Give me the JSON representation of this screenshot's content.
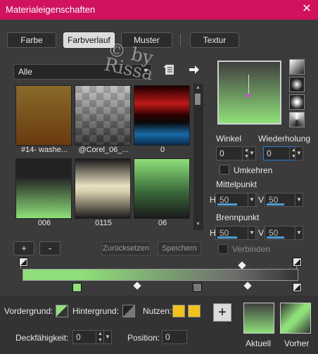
{
  "window": {
    "title": "Materialeigenschaften",
    "close_icon": "✕"
  },
  "tabs": [
    {
      "label": "Farbe"
    },
    {
      "label": "Farbverlauf"
    },
    {
      "label": "Muster"
    },
    {
      "label": "Textur"
    }
  ],
  "filter": {
    "value": "Alle",
    "arrow": "▼"
  },
  "gallery": [
    {
      "caption": "#14- washe..."
    },
    {
      "caption": "@Corel_06_..."
    },
    {
      "caption": "0"
    },
    {
      "caption": "006"
    },
    {
      "caption": "0115"
    },
    {
      "caption": "06"
    }
  ],
  "gallery_buttons": {
    "add": "+",
    "remove": "-",
    "reset": "Zurücksetzen",
    "save": "Speichern"
  },
  "watermark": {
    "line1": "© by",
    "line2": "Rissa"
  },
  "angle": {
    "label": "Winkel",
    "value": "0"
  },
  "repeat": {
    "label": "Wiederholung",
    "value": "0"
  },
  "invert": {
    "label": "Umkehren"
  },
  "midpoint": {
    "label": "Mittelpunkt",
    "h_label": "H",
    "h_value": "50",
    "v_label": "V",
    "v_value": "50"
  },
  "focal": {
    "label": "Brennpunkt",
    "h_label": "H",
    "h_value": "50",
    "v_label": "V",
    "v_value": "50"
  },
  "link": {
    "label": "Verbinden"
  },
  "bottom": {
    "foreground_label": "Vordergrund:",
    "background_label": "Hintergrund:",
    "use_label": "Nutzen:",
    "opacity_label": "Deckfähigkeit:",
    "opacity_value": "0",
    "position_label": "Position:",
    "position_value": "0",
    "add_label": "+",
    "current_label": "Aktuell",
    "previous_label": "Vorher"
  },
  "colors": {
    "accent": "#d0125f",
    "gradient_start": "#8fe07a",
    "gradient_end": "#333333",
    "use_swatch": "#f2c21b"
  }
}
